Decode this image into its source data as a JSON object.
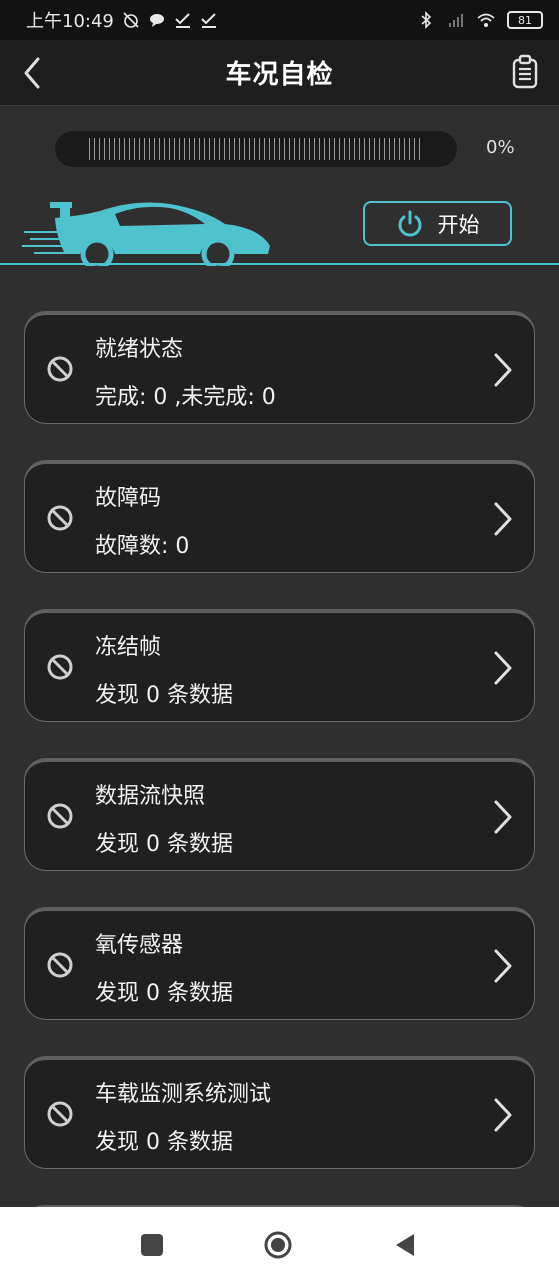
{
  "status_bar": {
    "time": "上午10:49",
    "battery": "81",
    "icons": [
      "alarm-off-icon",
      "chat-icon",
      "check-icon",
      "check-icon",
      "bluetooth-icon",
      "signal-icon",
      "wifi-icon",
      "battery-icon"
    ]
  },
  "header": {
    "title": "车况自检",
    "back_icon": "chevron-left-icon",
    "report_icon": "clipboard-icon"
  },
  "progress": {
    "percent_label": "0%",
    "value": 0
  },
  "start_button": {
    "label": "开始",
    "icon": "power-icon"
  },
  "colors": {
    "accent": "#4ec3ce",
    "background": "#2f2f2f",
    "card": "#202020",
    "header": "#1e1e1e"
  },
  "items": [
    {
      "title": "就绪状态",
      "subtitle": "完成: 0 ,未完成: 0"
    },
    {
      "title": "故障码",
      "subtitle": "故障数: 0"
    },
    {
      "title": "冻结帧",
      "subtitle": "发现 0 条数据"
    },
    {
      "title": "数据流快照",
      "subtitle": "发现 0 条数据"
    },
    {
      "title": "氧传感器",
      "subtitle": "发现 0 条数据"
    },
    {
      "title": "车载监测系统测试",
      "subtitle": "发现 0 条数据"
    }
  ],
  "nav": {
    "icons": [
      "recent-apps-icon",
      "home-icon",
      "back-icon"
    ]
  }
}
